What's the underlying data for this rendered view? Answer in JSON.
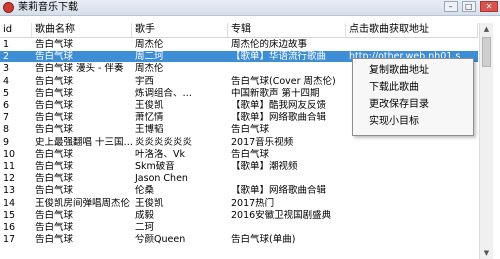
{
  "window": {
    "title": "茉莉音乐下载",
    "controls": [
      "–",
      "□",
      "✕"
    ]
  },
  "table": {
    "columns": [
      "id",
      "歌曲名称",
      "歌手",
      "专辑",
      "点击歌曲获取地址"
    ],
    "selected_index": 1,
    "rows": [
      {
        "id": "1",
        "name": "告白气球",
        "artist": "周杰伦",
        "album": "周杰伦的床边故事",
        "url": ""
      },
      {
        "id": "2",
        "name": "告白气球",
        "artist": "周二珂",
        "album": "【歌单】华语流行歌曲",
        "url": "http://other.web.nh01.s"
      },
      {
        "id": "3",
        "name": "告白气球 漫头 - 伴奏",
        "artist": "周杰伦",
        "album": "",
        "url": ""
      },
      {
        "id": "4",
        "name": "告白气球",
        "artist": "宇西",
        "album": "告白气球(Cover 周杰伦)",
        "url": ""
      },
      {
        "id": "5",
        "name": "告白气球",
        "artist": "炼调组合、…",
        "album": "中国新歌声 第十四期",
        "url": ""
      },
      {
        "id": "6",
        "name": "告白气球",
        "artist": "王俊凯",
        "album": "【歌单】酷我网友反馈",
        "url": ""
      },
      {
        "id": "7",
        "name": "告白气球",
        "artist": "萧忆情",
        "album": "【歌单】网络歌曲合辑",
        "url": ""
      },
      {
        "id": "8",
        "name": "告白气球",
        "artist": "王博韬",
        "album": "告白气球",
        "url": ""
      },
      {
        "id": "9",
        "name": "史上最强翻唱 十三国…",
        "artist": "炎炎炎炎炎炎",
        "album": "2017音乐视频",
        "url": ""
      },
      {
        "id": "10",
        "name": "告白气球",
        "artist": "叶洛洛、Vk",
        "album": "告白气球",
        "url": ""
      },
      {
        "id": "11",
        "name": "告白气球",
        "artist": "Skm破音",
        "album": "【歌单】潮视频",
        "url": ""
      },
      {
        "id": "12",
        "name": "告白气球",
        "artist": "Jason Chen",
        "album": "",
        "url": ""
      },
      {
        "id": "13",
        "name": "告白气球",
        "artist": "伦桑",
        "album": "【歌单】网络歌曲合辑",
        "url": ""
      },
      {
        "id": "14",
        "name": "王俊凯房间弹唱周杰伦",
        "artist": "王俊凯",
        "album": "2017热门",
        "url": ""
      },
      {
        "id": "15",
        "name": "告白气球",
        "artist": "成毅",
        "album": "2016安徽卫视国剧盛典",
        "url": ""
      },
      {
        "id": "16",
        "name": "告白气球",
        "artist": "二珂",
        "album": "",
        "url": ""
      },
      {
        "id": "17",
        "name": "告白气球",
        "artist": "兮颜Queen",
        "album": "告白气球(单曲)",
        "url": ""
      }
    ]
  },
  "context_menu": {
    "items": [
      "复制歌曲地址",
      "下载此歌曲",
      "更改保存目录",
      "实现小目标"
    ]
  },
  "scrollbar": {
    "up": "▲",
    "down": "▼"
  }
}
